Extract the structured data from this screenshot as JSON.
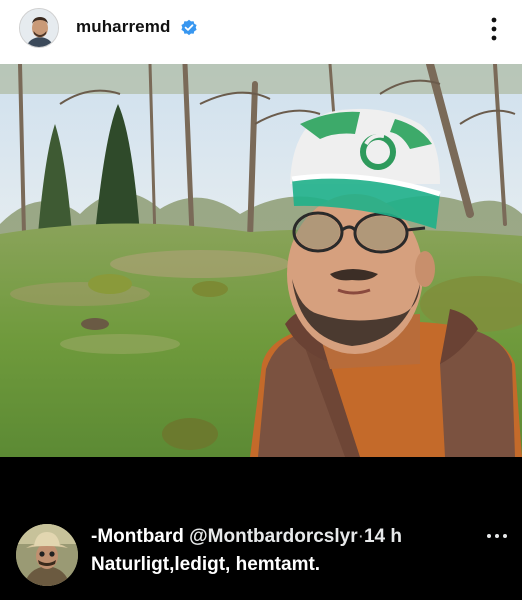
{
  "instagram_post": {
    "username": "muharremd",
    "verified_icon": "verified-badge-icon",
    "more_icon": "more-vertical-icon",
    "accent_color": "#3897f0"
  },
  "tweet": {
    "display_name": "-Montbard",
    "handle": "@Montbardorcslyr",
    "separator": "·",
    "time": "14 h",
    "text": "Naturligt,ledigt, hemtamt.",
    "more_icon": "more-horizontal-icon"
  }
}
